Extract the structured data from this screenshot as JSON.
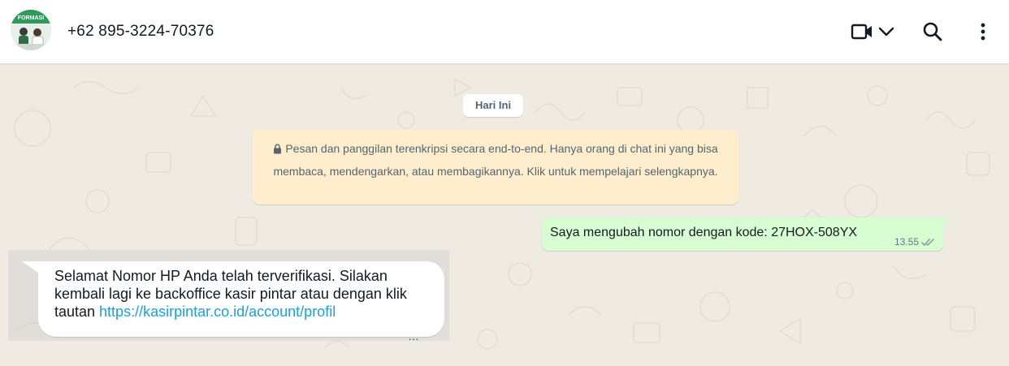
{
  "header": {
    "contact_name": "+62 895-3224-70376",
    "avatar_label": "FORMASI",
    "icons": [
      "video-call-icon",
      "chevron-down-icon",
      "search-icon",
      "menu-dots-icon"
    ]
  },
  "chat": {
    "date_chip": "Hari Ini",
    "encryption_notice": "Pesan dan panggilan terenkripsi secara end-to-end. Hanya orang di chat ini yang bisa membaca, mendengarkan, atau membagikannya. Klik untuk mempelajari selengkapnya.",
    "messages": [
      {
        "direction": "outgoing",
        "text": "Saya mengubah nomor dengan kode: 27HOX-508YX",
        "time": "13.55",
        "status": "read"
      },
      {
        "direction": "incoming",
        "text": "Selamat Nomor HP Anda telah terverifikasi. Silakan kembali lagi ke backoffice kasir pintar atau dengan klik tautan ",
        "link": "https://kasirpintar.co.id/account/profil",
        "trailing": "..."
      }
    ]
  },
  "colors": {
    "outgoing_bubble": "#d9fdd3",
    "notice_background": "#ffeecd",
    "link": "#1f9fd5",
    "chat_background": "#efeae2"
  }
}
